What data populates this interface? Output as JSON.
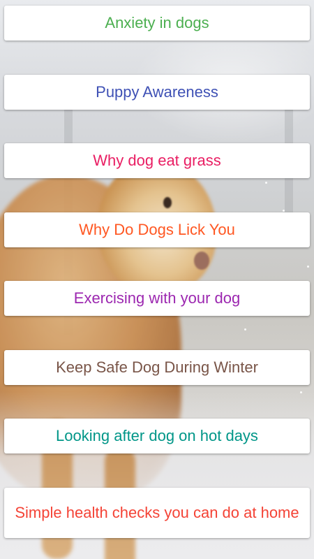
{
  "menu": {
    "items": [
      {
        "label": "Anxiety in dogs",
        "color": "#4caf50"
      },
      {
        "label": "Puppy Awareness",
        "color": "#3f51b5"
      },
      {
        "label": "Why dog eat grass",
        "color": "#e91e63"
      },
      {
        "label": "Why Do Dogs Lick You",
        "color": "#ff5722"
      },
      {
        "label": "Exercising with your dog",
        "color": "#9c27b0"
      },
      {
        "label": "Keep Safe Dog During Winter",
        "color": "#795548"
      },
      {
        "label": "Looking after dog on hot days",
        "color": "#009688"
      },
      {
        "label": "Simple health checks you can do at home",
        "color": "#f44336"
      }
    ]
  },
  "background": {
    "image": "golden-retriever-snow-image"
  }
}
